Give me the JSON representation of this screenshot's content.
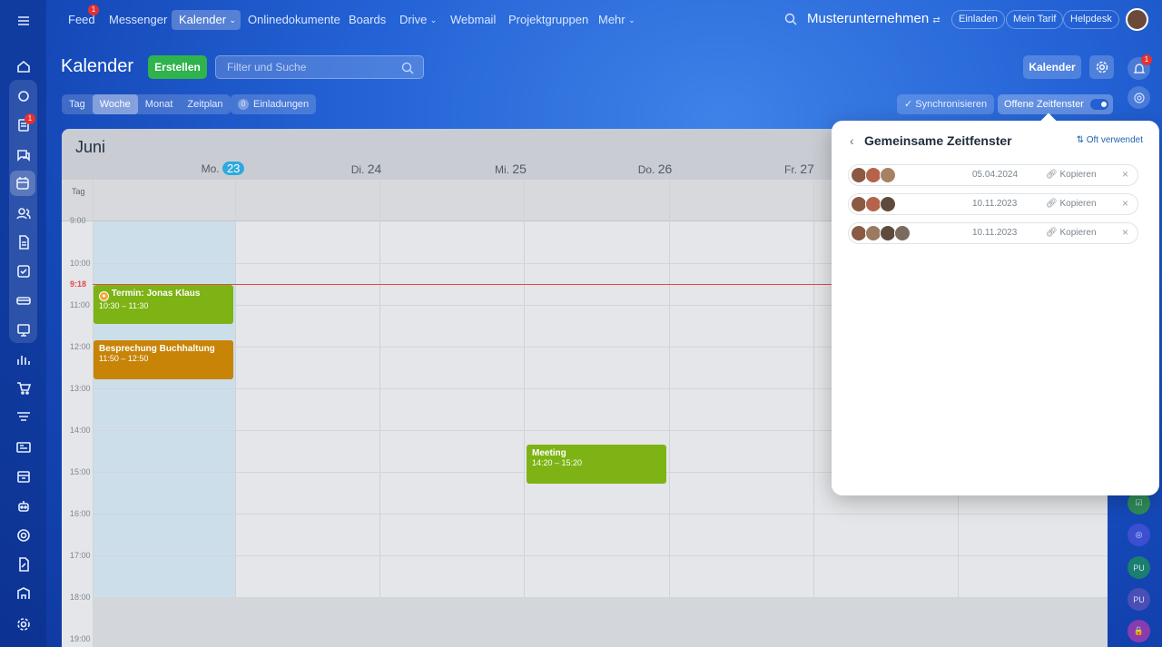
{
  "topnav": {
    "items": [
      {
        "label": "Feed",
        "badge": "1"
      },
      {
        "label": "Messenger"
      },
      {
        "label": "Kalender"
      },
      {
        "label": "Onlinedokumente"
      },
      {
        "label": "Boards"
      },
      {
        "label": "Drive"
      },
      {
        "label": "Webmail"
      },
      {
        "label": "Projektgruppen"
      },
      {
        "label": "Mehr"
      }
    ],
    "company": "Musterunternehmen",
    "invite": "Einladen",
    "tariff": "Mein Tarif",
    "help": "Helpdesk"
  },
  "leftbar": {
    "badge_feed": "1"
  },
  "header": {
    "title": "Kalender",
    "create": "Erstellen",
    "search_placeholder": "Filter und Suche",
    "calendar_button": "Kalender",
    "notifications_badge": "1"
  },
  "viewtabs": [
    "Tag",
    "Woche",
    "Monat",
    "Zeitplan"
  ],
  "invitations": {
    "count": "0",
    "label": "Einladungen"
  },
  "sync_label": "Synchronisieren",
  "open_slots_label": "Offene Zeitfenster",
  "calendar": {
    "month": "Juni",
    "days": [
      {
        "name": "Mo.",
        "num": "23",
        "today": true
      },
      {
        "name": "Di.",
        "num": "24"
      },
      {
        "name": "Mi.",
        "num": "25"
      },
      {
        "name": "Do.",
        "num": "26"
      },
      {
        "name": "Fr.",
        "num": "27"
      }
    ],
    "allday_label": "Tag",
    "now_label": "9:18",
    "hours": [
      "9:00",
      "10:00",
      "11:00",
      "12:00",
      "13:00",
      "14:00",
      "15:00",
      "16:00",
      "17:00",
      "18:00",
      "19:00"
    ],
    "events": [
      {
        "title": "Termin: Jonas Klaus",
        "time": "10:30 – 11:30",
        "color": "#7db314"
      },
      {
        "title": "Besprechung Buchhaltung",
        "time": "11:50 – 12:50",
        "color": "#c78407"
      },
      {
        "title": "Meeting",
        "time": "14:20 – 15:20",
        "color": "#7db314"
      }
    ]
  },
  "popup": {
    "title": "Gemeinsame Zeitfenster",
    "sort": "Oft verwendet",
    "slots": [
      {
        "date": "05.04.2024",
        "copy": "Kopieren"
      },
      {
        "date": "10.11.2023",
        "copy": "Kopieren"
      },
      {
        "date": "10.11.2023",
        "copy": "Kopieren"
      }
    ]
  },
  "rightbar": {
    "pu1": "PU",
    "pu2": "PU"
  }
}
